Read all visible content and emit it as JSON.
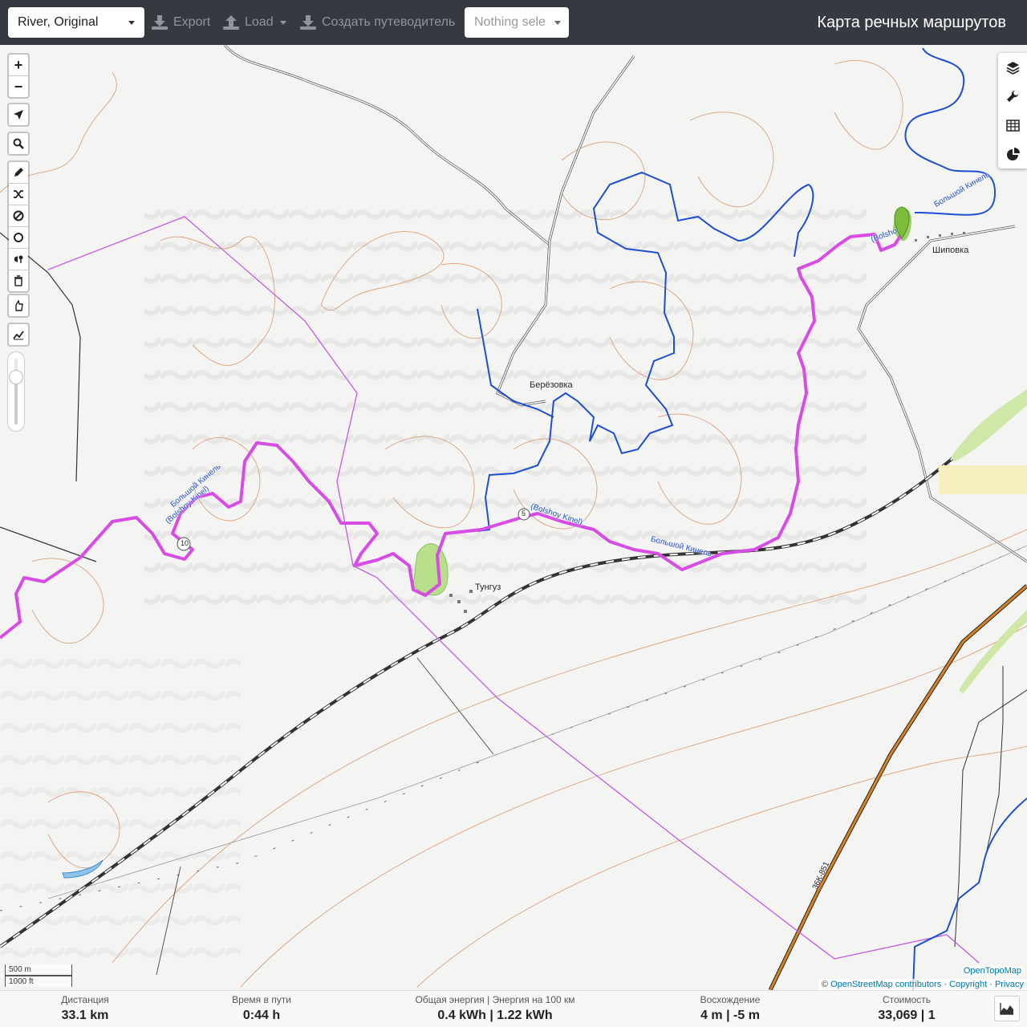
{
  "topbar": {
    "profile": "River, Original",
    "export": "Export",
    "load": "Load",
    "guide": "Создать путеводитель",
    "selector": "Nothing sele",
    "title": "Карта речных маршрутов"
  },
  "map": {
    "labels": {
      "berezovka": "Берёзовка",
      "shipovka": "Шиповка",
      "tunguz": "Тунгуз",
      "river_ru_1": "Большой Кинель",
      "river_en_1": "(Bolshoy Kinel)",
      "river_en_2": "(Bolshoy Kinel)",
      "river_ru_3": "Большой Кинель",
      "river_ru_4": "Большой Кинель",
      "river_en_4": "(Bolsho",
      "road_ref": "36К-851",
      "km_10": "10",
      "km_5": "5"
    },
    "scale": {
      "metric": "500 m",
      "imperial": "1000 ft"
    },
    "attribution": {
      "tiles": "OpenTopoMap",
      "copy": "©",
      "osm": "OpenStreetMap contributors",
      "sep1": "·",
      "copyright": "Copyright",
      "sep2": "·",
      "privacy": "Privacy"
    },
    "opacity_slider": 0.75,
    "colors": {
      "route": "#d84ce6",
      "river": "#1f4fd1",
      "railway": "#333333",
      "boundary": "#c35ce6",
      "highway": "#d9821e"
    }
  },
  "controls": {
    "zoom_in": "+",
    "zoom_out": "−",
    "icons": [
      "locate-icon",
      "search-icon",
      "draw-icon",
      "shuffle-icon",
      "no-entry-icon",
      "circle-icon",
      "pin-icon",
      "delete-icon",
      "poi-icon",
      "elevation-icon"
    ],
    "right_icons": [
      "layers-icon",
      "wrench-icon",
      "table-icon",
      "pie-chart-icon"
    ]
  },
  "stats": {
    "distance": {
      "title": "Дистанция",
      "value": "33.1 km"
    },
    "time": {
      "title": "Время в пути",
      "value": "0:44 h"
    },
    "energy": {
      "title": "Общая энергия | Энергия на 100 км",
      "value": "0.4 kWh | 1.22 kWh"
    },
    "ascent": {
      "title": "Восхождение",
      "value": "4 m | -5 m"
    },
    "cost": {
      "title": "Стоимость",
      "value": "33,069 | 1"
    }
  }
}
